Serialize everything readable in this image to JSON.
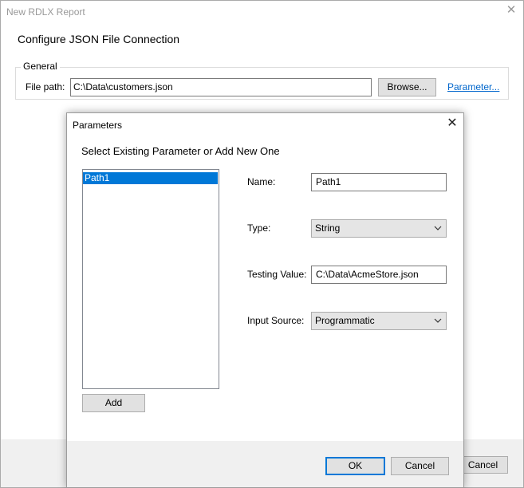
{
  "window": {
    "title": "New RDLX Report",
    "close_glyph": "✕",
    "heading": "Configure JSON File Connection"
  },
  "general": {
    "legend": "General",
    "file_path_label": "File path:",
    "file_path_value": "C:\\Data\\customers.json",
    "browse_label": "Browse...",
    "parameter_link": "Parameter..."
  },
  "outer_footer": {
    "cancel_label": "Cancel"
  },
  "dialog": {
    "title": "Parameters",
    "close_glyph": "✕",
    "subtitle": "Select Existing Parameter or Add New One",
    "parameters": [
      "Path1"
    ],
    "selected_parameter": "Path1",
    "add_label": "Add",
    "name_label": "Name:",
    "name_value": "Path1",
    "type_label": "Type:",
    "type_value": "String",
    "testing_label": "Testing Value:",
    "testing_value": "C:\\Data\\AcmeStore.json",
    "input_source_label": "Input Source:",
    "input_source_value": "Programmatic",
    "ok_label": "OK",
    "cancel_label": "Cancel"
  }
}
